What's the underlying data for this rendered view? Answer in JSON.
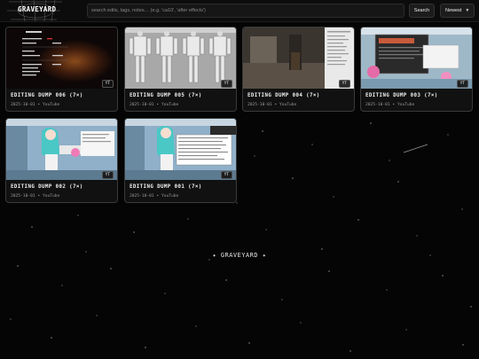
{
  "header": {
    "logo_text": "GRAVEYARD",
    "search_placeholder": "search edits, tags, notes… (e.g. 'ca10', 'after effects')",
    "search_button": "Search",
    "sort_value": "Newest"
  },
  "cards": [
    {
      "title": "EDITING DUMP 006 (7×)",
      "meta": "2025-10-01 • YouTube",
      "badge": "YT"
    },
    {
      "title": "EDITING DUMP 005 (7×)",
      "meta": "2025-10-01 • YouTube",
      "badge": "YT"
    },
    {
      "title": "EDITING DUMP 004 (7×)",
      "meta": "2025-10-01 • YouTube",
      "badge": "YT"
    },
    {
      "title": "EDITING DUMP 003 (7×)",
      "meta": "2025-10-01 • YouTube",
      "badge": "YT"
    },
    {
      "title": "EDITING DUMP 002 (7×)",
      "meta": "2025-10-01 • YouTube",
      "badge": "YT"
    },
    {
      "title": "EDITING DUMP 001 (7×)",
      "meta": "2025-10-01 • YouTube",
      "badge": "YT"
    }
  ],
  "footer": {
    "text": "✦ GRAVEYARD ✦"
  }
}
